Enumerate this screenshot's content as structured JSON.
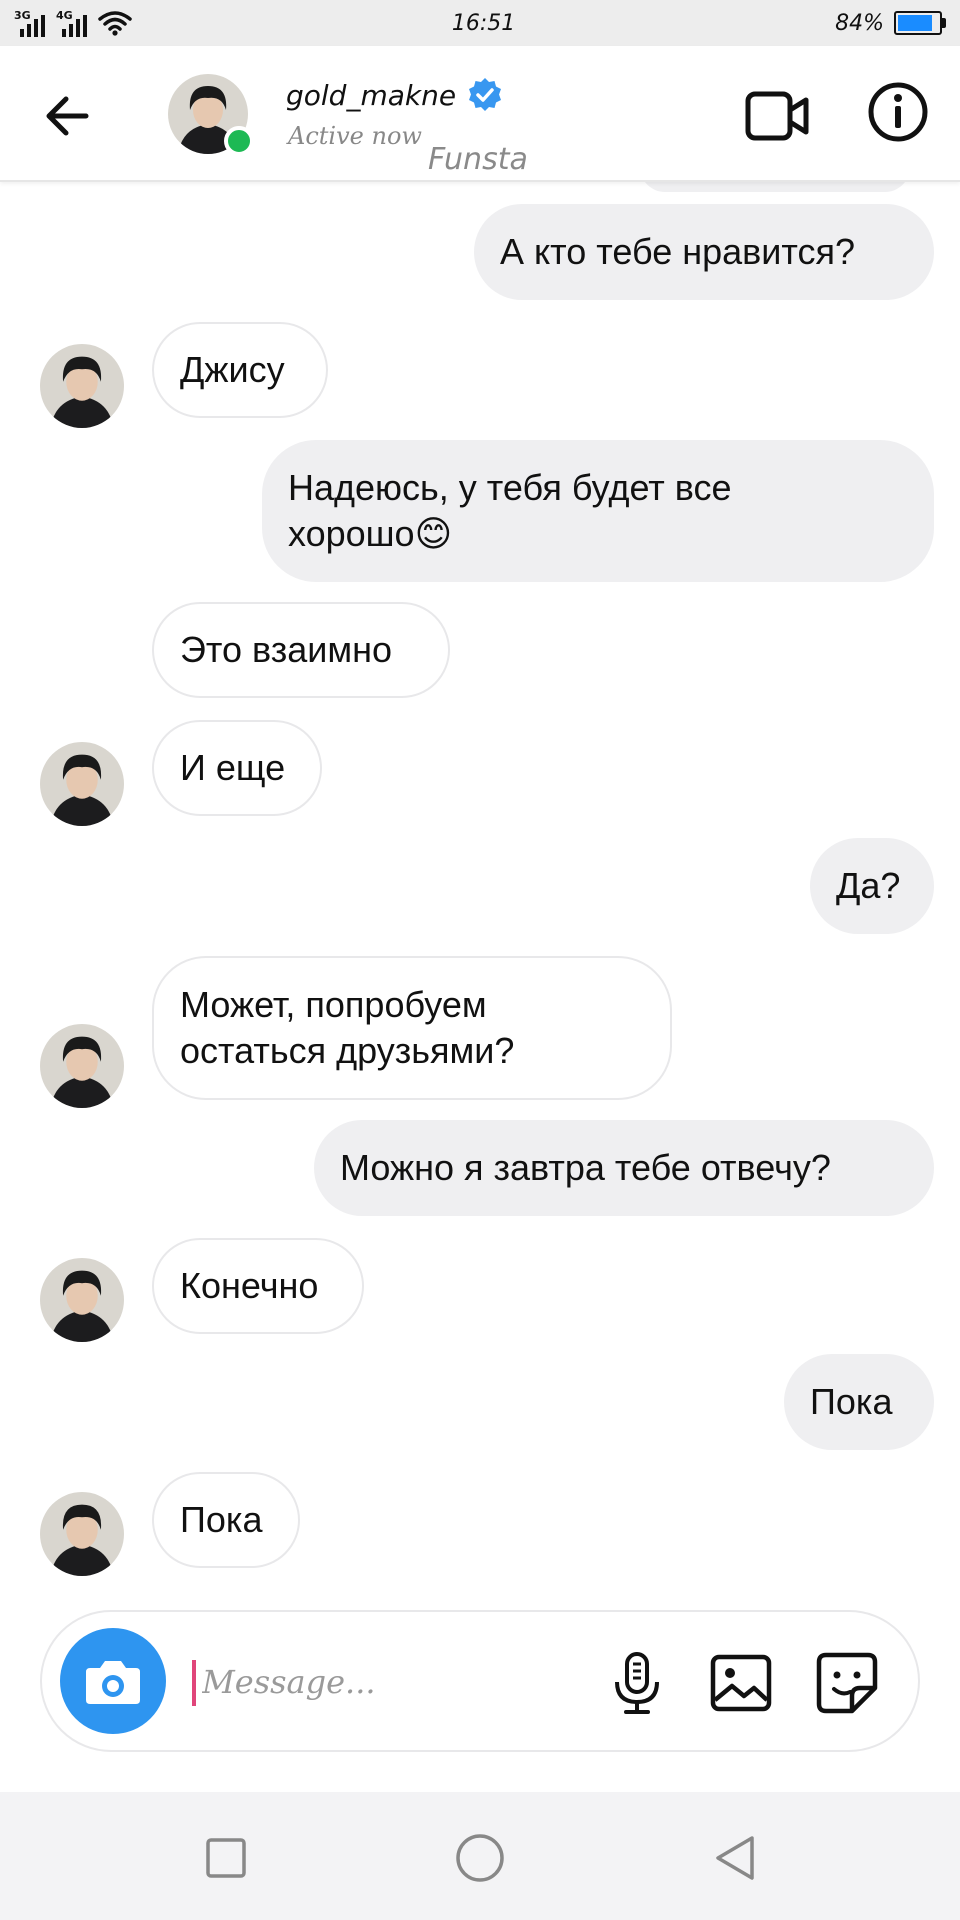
{
  "status_bar": {
    "net1": "3G",
    "net2": "4G",
    "time": "16:51",
    "battery": "84%",
    "battery_level": 0.84
  },
  "header": {
    "username": "gold_makne",
    "status": "Active now",
    "watermark": "Funsta",
    "icons": [
      "back-arrow-icon",
      "verified-badge-icon",
      "video-call-icon",
      "info-icon"
    ]
  },
  "messages": [
    {
      "side": "out",
      "text": "А кто тебе нравится?"
    },
    {
      "side": "in",
      "text": "Джису"
    },
    {
      "side": "out",
      "text": "Надеюсь, у тебя будет все хорошо😊"
    },
    {
      "side": "in",
      "text": "Это взаимно"
    },
    {
      "side": "in",
      "text": "И еще"
    },
    {
      "side": "out",
      "text": "Да?"
    },
    {
      "side": "in",
      "text": "Может, попробуем остаться друзьями?"
    },
    {
      "side": "out",
      "text": "Можно я завтра тебе отвечу?"
    },
    {
      "side": "in",
      "text": "Конечно"
    },
    {
      "side": "out",
      "text": "Пока"
    },
    {
      "side": "in",
      "text": "Пока"
    }
  ],
  "composer": {
    "placeholder": "Message...",
    "value": "",
    "icons": [
      "camera-icon",
      "microphone-icon",
      "gallery-icon",
      "sticker-icon"
    ]
  },
  "colors": {
    "accent": "#2e95f0",
    "online": "#1db954",
    "verified": "#3897f0",
    "outgoing_bubble": "#efeff1"
  }
}
